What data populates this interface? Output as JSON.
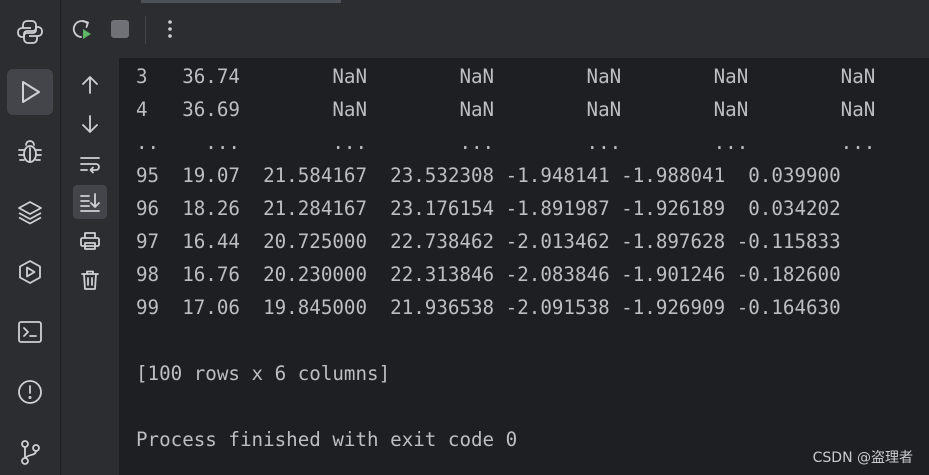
{
  "sidebar": {
    "items": [
      {
        "icon": "python-icon"
      },
      {
        "icon": "run-icon",
        "active": true
      },
      {
        "icon": "debug-icon"
      },
      {
        "icon": "layers-icon"
      },
      {
        "icon": "services-icon"
      },
      {
        "icon": "terminal-icon"
      },
      {
        "icon": "problems-icon"
      },
      {
        "icon": "git-icon"
      }
    ]
  },
  "toolbar": {
    "buttons": [
      "rerun-icon",
      "stop-icon",
      "more-icon"
    ]
  },
  "console": {
    "lines": [
      "3   36.74        NaN        NaN        NaN        NaN        NaN",
      "4   36.69        NaN        NaN        NaN        NaN        NaN",
      "..    ...        ...        ...        ...        ...        ...",
      "95  19.07  21.584167  23.532308 -1.948141 -1.988041  0.039900",
      "96  18.26  21.284167  23.176154 -1.891987 -1.926189  0.034202",
      "97  16.44  20.725000  22.738462 -2.013462 -1.897628 -0.115833",
      "98  16.76  20.230000  22.313846 -2.083846 -1.901246 -0.182600",
      "99  17.06  19.845000  21.936538 -2.091538 -1.926909 -0.164630",
      "",
      "[100 rows x 6 columns]",
      "",
      "Process finished with exit code 0"
    ]
  },
  "watermark": "CSDN @盗理者",
  "colors": {
    "background": "#1e1f22",
    "panel": "#2b2d30",
    "text": "#bcbec4",
    "icon": "#ced0d6",
    "run_green": "#5fb865"
  }
}
